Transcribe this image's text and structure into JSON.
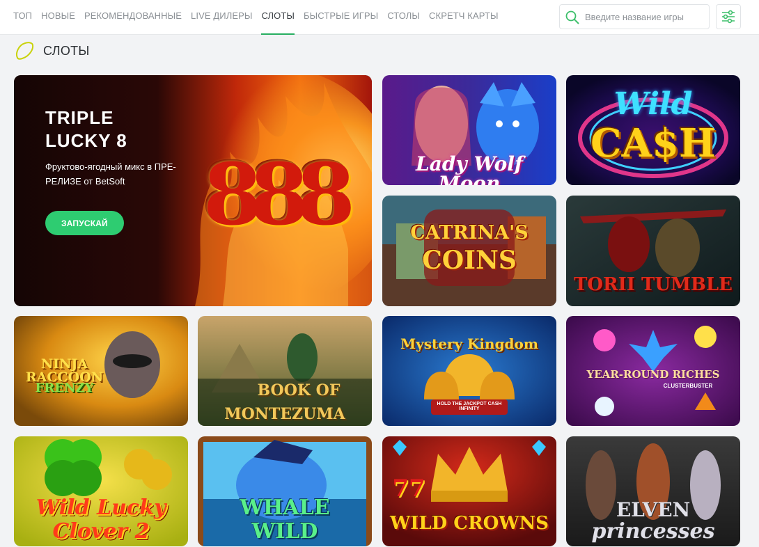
{
  "nav": {
    "items": [
      {
        "label": "ТОП",
        "active": false
      },
      {
        "label": "НОВЫЕ",
        "active": false
      },
      {
        "label": "РЕКОМЕНДОВАННЫЕ",
        "active": false
      },
      {
        "label": "LIVE ДИЛЕРЫ",
        "active": false
      },
      {
        "label": "СЛОТЫ",
        "active": true
      },
      {
        "label": "БЫСТРЫЕ ИГРЫ",
        "active": false
      },
      {
        "label": "СТОЛЫ",
        "active": false
      },
      {
        "label": "СКРЕТЧ КАРТЫ",
        "active": false
      }
    ],
    "accent_color": "#27ae60"
  },
  "search": {
    "placeholder": "Введите название игры",
    "value": "",
    "icon": "search-icon"
  },
  "filter": {
    "icon": "filter-sliders-icon"
  },
  "section": {
    "title": "СЛОТЫ",
    "icon": "lemon-icon"
  },
  "hero": {
    "title_line1": "TRIPLE",
    "title_line2": "LUCKY 8",
    "description": "Фруктово-ягодный микс в ПРЕ-РЕЛИЗЕ от BetSoft",
    "button_label": "ЗАПУСКАЙ",
    "button_color": "#2ecc71",
    "art_text": "888"
  },
  "games": [
    {
      "title": "Lady Wolf Moon"
    },
    {
      "title_line1": "Wild",
      "title_line2": "CA$H"
    },
    {
      "title_line1": "CATRINA'S",
      "title_line2": "COINS"
    },
    {
      "title": "TORII TUMBLE"
    },
    {
      "title_line1": "NINJA RACCOON",
      "title_line2": "FRENZY"
    },
    {
      "title_line1": "BOOK OF",
      "title_line2": "MONTEZUMA"
    },
    {
      "title": "Mystery Kingdom",
      "subtitle": "HOLD THE JACKPOT CASH INFINITY"
    },
    {
      "title": "YEAR-ROUND RICHES",
      "subtitle": "CLUSTERBUSTER"
    },
    {
      "title_line1": "Wild Lucky",
      "title_line2": "Clover 2"
    },
    {
      "title_line1": "WHALE",
      "title_line2": "WILD"
    },
    {
      "title": "WILD CROWNS",
      "badge": "77"
    },
    {
      "title_line1": "ELVEN",
      "title_line2": "princesses"
    }
  ]
}
